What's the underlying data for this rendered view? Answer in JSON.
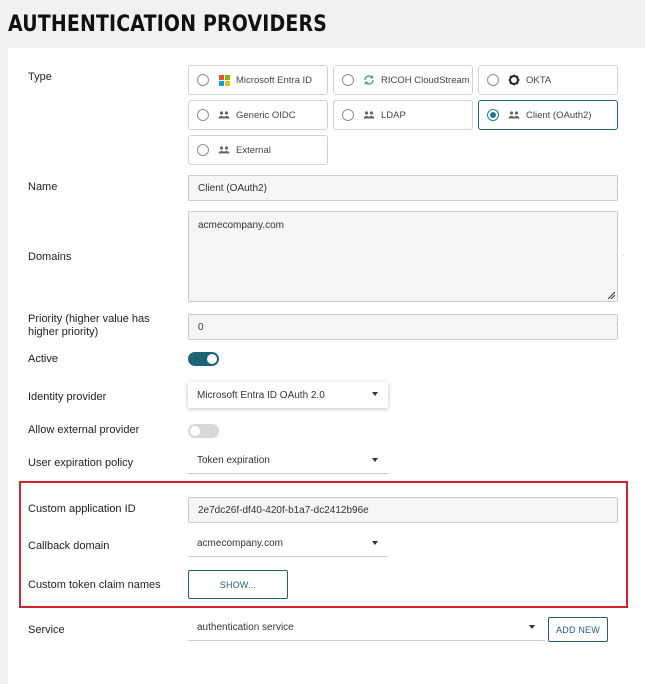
{
  "page": {
    "title": "AUTHENTICATION PROVIDERS"
  },
  "form": {
    "type": {
      "label": "Type",
      "options": [
        {
          "label": "Microsoft Entra ID",
          "icon": "microsoft-logo-icon",
          "selected": false
        },
        {
          "label": "RICOH CloudStream",
          "icon": "cloud-sync-icon",
          "selected": false
        },
        {
          "label": "OKTA",
          "icon": "okta-logo-icon",
          "selected": false
        },
        {
          "label": "Generic OIDC",
          "icon": "users-icon",
          "selected": false
        },
        {
          "label": "LDAP",
          "icon": "users-icon",
          "selected": false
        },
        {
          "label": "Client (OAuth2)",
          "icon": "users-icon",
          "selected": true
        },
        {
          "label": "External",
          "icon": "users-icon",
          "selected": false
        }
      ]
    },
    "name": {
      "label": "Name",
      "value": "Client (OAuth2)"
    },
    "domains": {
      "label": "Domains",
      "value": "acmecompany.com"
    },
    "priority": {
      "label": "Priority (higher value has higher priority)",
      "value": "0"
    },
    "active": {
      "label": "Active",
      "enabled": true
    },
    "identity_provider": {
      "label": "Identity provider",
      "value": "Microsoft Entra ID OAuth 2.0"
    },
    "allow_external": {
      "label": "Allow external provider",
      "enabled": false
    },
    "user_expiration": {
      "label": "User expiration policy",
      "value": "Token expiration"
    },
    "custom_app_id": {
      "label": "Custom application ID",
      "value": "2e7dc26f-df40-420f-b1a7-dc2412b96e"
    },
    "callback_domain": {
      "label": "Callback domain",
      "value": "acmecompany.com"
    },
    "custom_claims": {
      "label": "Custom token claim names",
      "button": "SHOW..."
    },
    "service": {
      "label": "Service",
      "value": "authentication service",
      "add_button": "ADD NEW"
    }
  },
  "colors": {
    "accent": "#1e6478",
    "highlight": "#d1222d",
    "background": "#f0f1f3"
  }
}
